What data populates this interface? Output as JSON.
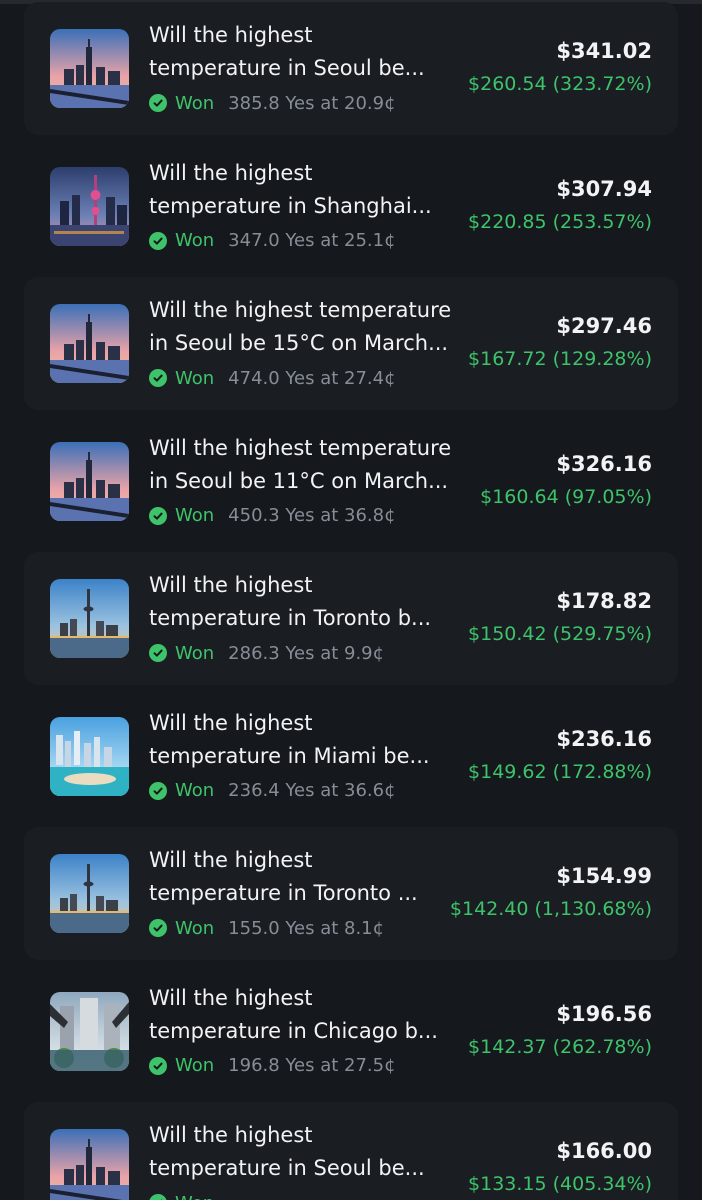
{
  "colors": {
    "background": "#15181c",
    "card": "#1a1e23",
    "text_primary": "#f1f3f5",
    "text_secondary": "#868d96",
    "positive": "#3ec26a"
  },
  "positions": [
    {
      "thumbnail": "seoul-city-icon",
      "title_line1": "Will the highest",
      "title_line2": "temperature in Seoul be...",
      "status": "Won",
      "detail": "385.8 Yes at 20.9¢",
      "value": "$341.02",
      "pnl": "$260.54 (323.72%)"
    },
    {
      "thumbnail": "shanghai-city-icon",
      "title_line1": "Will the highest",
      "title_line2": "temperature in Shanghai...",
      "status": "Won",
      "detail": "347.0 Yes at 25.1¢",
      "value": "$307.94",
      "pnl": "$220.85 (253.57%)"
    },
    {
      "thumbnail": "seoul-city-icon",
      "title_line1": "Will the highest temperature",
      "title_line2": "in Seoul be 15°C on March...",
      "status": "Won",
      "detail": "474.0 Yes at 27.4¢",
      "value": "$297.46",
      "pnl": "$167.72 (129.28%)"
    },
    {
      "thumbnail": "seoul-city-icon",
      "title_line1": "Will the highest temperature",
      "title_line2": "in Seoul be 11°C on March...",
      "status": "Won",
      "detail": "450.3 Yes at 36.8¢",
      "value": "$326.16",
      "pnl": "$160.64 (97.05%)"
    },
    {
      "thumbnail": "toronto-city-icon",
      "title_line1": "Will the highest",
      "title_line2": "temperature in Toronto b...",
      "status": "Won",
      "detail": "286.3 Yes at 9.9¢",
      "value": "$178.82",
      "pnl": "$150.42 (529.75%)"
    },
    {
      "thumbnail": "miami-city-icon",
      "title_line1": "Will the highest",
      "title_line2": "temperature in Miami be...",
      "status": "Won",
      "detail": "236.4 Yes at 36.6¢",
      "value": "$236.16",
      "pnl": "$149.62 (172.88%)"
    },
    {
      "thumbnail": "toronto-city-icon",
      "title_line1": "Will the highest",
      "title_line2": "temperature in Toronto ...",
      "status": "Won",
      "detail": "155.0 Yes at 8.1¢",
      "value": "$154.99",
      "pnl": "$142.40 (1,130.68%)"
    },
    {
      "thumbnail": "chicago-city-icon",
      "title_line1": "Will the highest",
      "title_line2": "temperature in Chicago b...",
      "status": "Won",
      "detail": "196.8 Yes at 27.5¢",
      "value": "$196.56",
      "pnl": "$142.37 (262.78%)"
    },
    {
      "thumbnail": "seoul-city-icon",
      "title_line1": "Will the highest",
      "title_line2": "temperature in Seoul be...",
      "status": "Won",
      "detail": "",
      "value": "$166.00",
      "pnl": "$133.15 (405.34%)"
    }
  ]
}
